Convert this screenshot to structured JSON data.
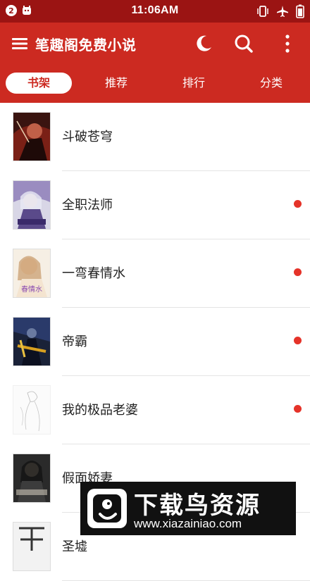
{
  "status_bar": {
    "badge": "2",
    "time": "11:06AM"
  },
  "app_bar": {
    "title": "笔趣阁免费小说",
    "icons": [
      "menu-icon",
      "moon-icon",
      "search-icon",
      "more-vert-icon"
    ]
  },
  "tabs": [
    {
      "label": "书架",
      "active": true
    },
    {
      "label": "推荐",
      "active": false
    },
    {
      "label": "排行",
      "active": false
    },
    {
      "label": "分类",
      "active": false
    }
  ],
  "books": [
    {
      "title": "斗破苍穹",
      "has_update": false
    },
    {
      "title": "全职法师",
      "has_update": true
    },
    {
      "title": "一弯春情水",
      "has_update": true
    },
    {
      "title": "帝霸",
      "has_update": true
    },
    {
      "title": "我的极品老婆",
      "has_update": true
    },
    {
      "title": "假面娇妻",
      "has_update": false
    },
    {
      "title": "圣墟",
      "has_update": false
    }
  ],
  "watermark": {
    "brand": "下载鸟资源",
    "url": "www.xiazainiao.com"
  },
  "colors": {
    "status_bar": "#9b1413",
    "app_bar": "#cc2a21",
    "update_dot": "#e53329"
  }
}
